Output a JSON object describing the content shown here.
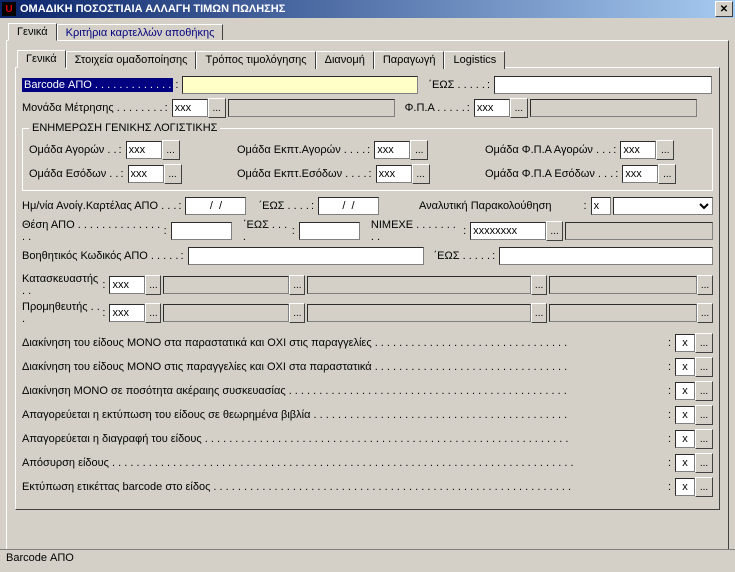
{
  "window": {
    "title": "ΟΜΑΔΙΚΗ ΠΟΣΟΣΤΙΑΙΑ ΑΛΛΑΓΗ ΤΙΜΩΝ ΠΩΛΗΣΗΣ"
  },
  "outerTabs": {
    "general": "Γενικά",
    "criteria": "Κριτήρια καρτελλών αποθήκης"
  },
  "innerTabs": {
    "general": "Γενικά",
    "grouping": "Στοιχεία ομαδοποίησης",
    "pricing": "Τρόπος τιμολόγησης",
    "distribution": "Διανομή",
    "production": "Παραγωγή",
    "logistics": "Logistics"
  },
  "fields": {
    "barcodeFrom_lbl": "Barcode ΑΠΟ . . . . . . . . . . . . .",
    "to_lbl": "΄ΕΩΣ . . . . .",
    "unit_lbl": "Μονάδα Μέτρησης . . . . . . . .",
    "vat_lbl": "Φ.Π.Α . . . . .",
    "xxx": "xxx",
    "dots": "...",
    "x": "x"
  },
  "glGroup": {
    "legend": "ΕΝΗΜΕΡΩΣΗ ΓΕΝΙΚΗΣ ΛΟΓΙΣΤΙΚΗΣ",
    "purch_lbl": "Ομάδα Αγορών . .",
    "rev_lbl": "Ομάδα Εσόδων . .",
    "discPurch_lbl": "Ομάδα Εκπτ.Αγορών . . . .",
    "discRev_lbl": "Ομάδα Εκπτ.Εσόδων . . . .",
    "vatPurch_lbl": "Ομάδα Φ.Π.Α Αγορών . . .",
    "vatRev_lbl": "Ομάδα Φ.Π.Α Εσόδων . . ."
  },
  "block2": {
    "openDate_lbl": "Ημ/νία Ανοίγ.Καρτέλας ΑΠΟ . . .",
    "dateMask": " /  / ",
    "to_lbl": "΄ΕΩΣ . . . .",
    "analytic_lbl": "Αναλυτική Παρακολούθηση",
    "posFrom_lbl": "Θέση  ΑΠΟ . . . . . . . . . . . . . . . .",
    "nimexe_lbl": "ΝΙΜΕΧΕ . . . . . . . . .",
    "nimexe_val": "xxxxxxxx",
    "auxCode_lbl": "Βοηθητικός Κωδικός ΑΠΟ . . . . .",
    "manuf_lbl": "Κατασκευαστής . .",
    "supplier_lbl": "Προμηθευτής . . ."
  },
  "checks": [
    "Διακίνηση του είδους ΜΟΝΟ στα παραστατικά και ΟΧΙ στις παραγγελίες . . . . . . . . . . . . . . . . . . . . . . . . . . . . . . . .",
    "Διακίνηση του είδους ΜΟΝΟ στις παραγγελίες και ΟΧΙ στα παραστατικά . . . . . . . . . . . . . . . . . . . . . . . . . . . . . . . .",
    "Διακίνηση ΜΟΝΟ σε ποσότητα ακέραιης συσκευασίας . . . . . . . . . . . . . . . . . . . . . . . . . . . . . . . . . . . . . . . . . . . . . .",
    "Απαγορεύεται η εκτύπωση του είδους σε θεωρημένα βιβλία . . . . . . . . . . . . . . . . . . . . . . . . . . . . . . . . . . . . . . . . . .",
    "Απαγορεύεται η διαγραφή του είδους . . . . . . . . . . . . . . . . . . . . . . . . . . . . . . . . . . . . . . . . . . . . . . . . . . . . . . . . . . . .",
    "Απόσυρση είδους . . . . . . . . . . . . . . . . . . . . . . . . . . . . . . . . . . . . . . . . . . . . . . . . . . . . . . . . . . . . . . . . . . . . . . . . . . . .",
    "Εκτύπωση ετικέττας barcode στο είδος . . . . . . . . . . . . . . . . . . . . . . . . . . . . . . . . . . . . . . . . . . . . . . . . . . . . . . . . . . ."
  ],
  "status": {
    "text": "Barcode ΑΠΟ"
  }
}
